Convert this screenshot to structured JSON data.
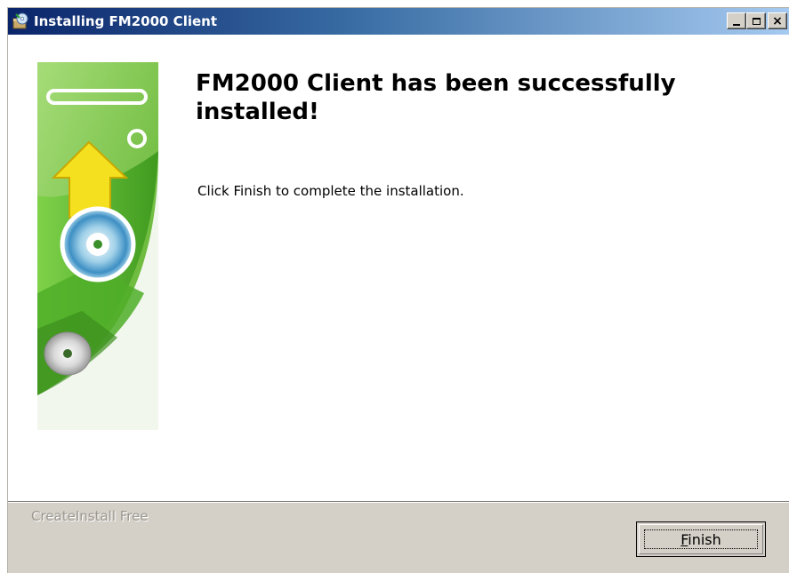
{
  "window": {
    "title": "Installing FM2000 Client",
    "app_icon": "installer-icon",
    "controls": {
      "minimize": "minimize-icon",
      "maximize": "maximize-icon",
      "close": "close-icon",
      "close_glyph": "×"
    }
  },
  "main": {
    "heading": "FM2000 Client has been successfully installed!",
    "instruction": "Click Finish to complete the installation.",
    "banner_icon": "install-cd-arrow-banner"
  },
  "footer": {
    "brand": "CreateInstall Free",
    "finish_access_key": "F",
    "finish_rest": "inish"
  },
  "colors": {
    "titlebar_start": "#0a246a",
    "titlebar_end": "#a6caf0",
    "banner_green": "#6cc23a",
    "arrow_yellow": "#f5e020",
    "dialog_gray": "#d4d0c8"
  }
}
